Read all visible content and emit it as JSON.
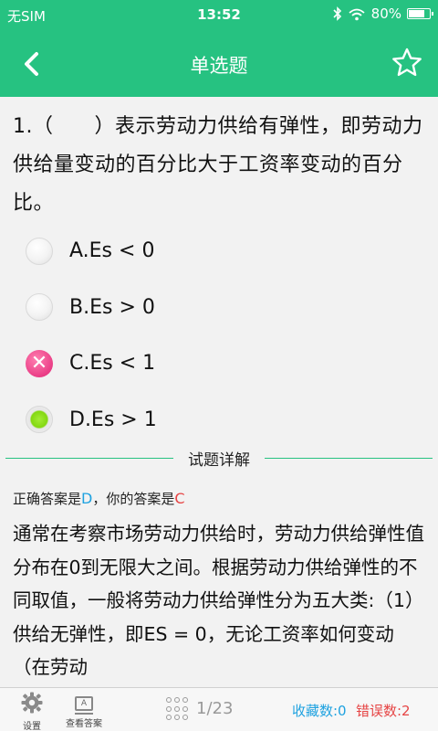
{
  "status_bar": {
    "carrier": "无SIM",
    "time": "13:52",
    "battery_percent": "80%",
    "battery_level": 0.8,
    "icons": [
      "bluetooth-icon",
      "wifi-icon",
      "battery-icon"
    ]
  },
  "nav": {
    "title": "单选题",
    "back_icon": "chevron-left-icon",
    "favorite_icon": "star-icon"
  },
  "question": {
    "text": "1.（　　）表示劳动力供给有弹性，即劳动力供给量变动的百分比大于工资率变动的百分比。"
  },
  "options": [
    {
      "label": "A.Es < 0",
      "state": "unselected"
    },
    {
      "label": "B.Es > 0",
      "state": "unselected"
    },
    {
      "label": "C.Es < 1",
      "state": "wrong"
    },
    {
      "label": "D.Es > 1",
      "state": "correct"
    }
  ],
  "explanation": {
    "section_title": "试题详解",
    "correct_prefix": "正确答案是",
    "correct_answer": "D",
    "your_prefix": "，你的答案是",
    "your_answer": "C",
    "text": "通常在考察市场劳动力供给时，劳动力供给弹性值分布在0到无限大之间。根据劳动力供给弹性的不同取值，一般将劳动力供给弹性分为五大类:（1）供给无弹性，即ES = 0，无论工资率如何变动（在劳动"
  },
  "bottom_bar": {
    "settings_label": "设置",
    "view_answer_label": "查看答案",
    "view_answer_icon_text": "A",
    "page": "1/23",
    "favorites": "收藏数:0",
    "errors": "错误数:2"
  },
  "colors": {
    "brand": "#26c281",
    "correct_blue": "#1fa2e0",
    "error_red": "#e64545",
    "wrong_pink": "#ea3e86",
    "right_green": "#83d811"
  }
}
